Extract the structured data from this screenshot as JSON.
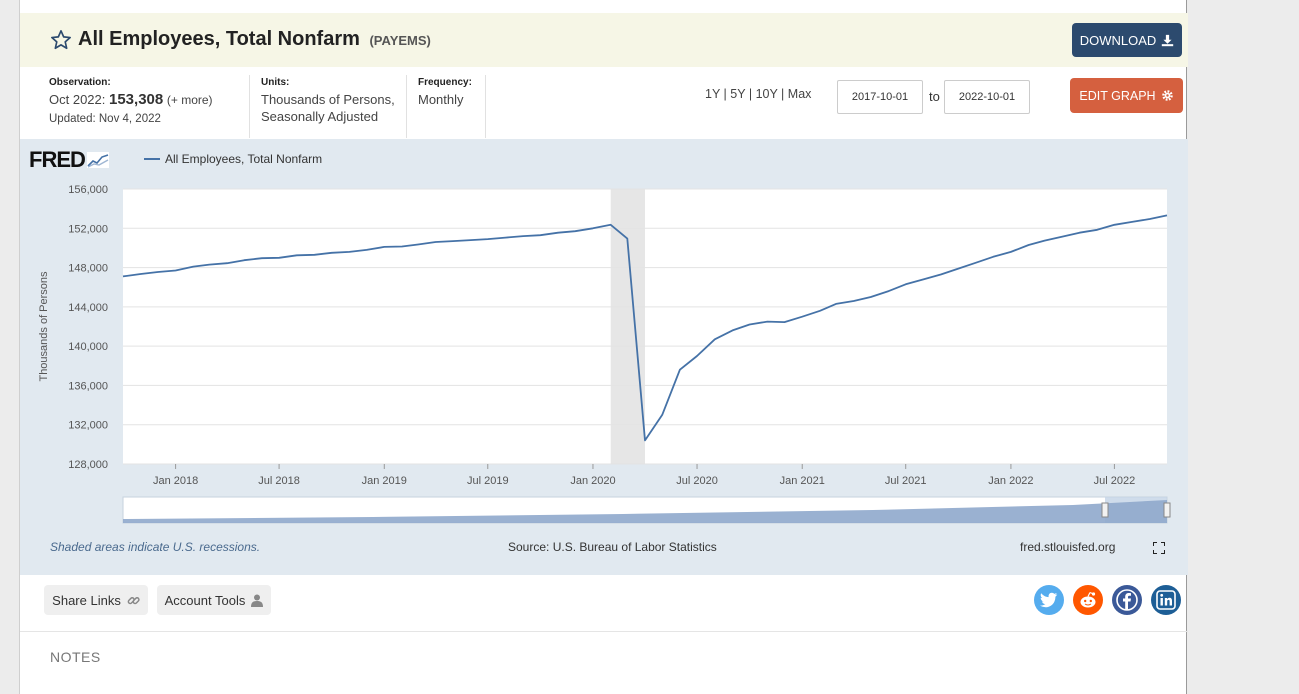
{
  "header": {
    "title": "All Employees, Total Nonfarm",
    "series_id": "(PAYEMS)",
    "download_label": "DOWNLOAD"
  },
  "meta": {
    "observation_label": "Observation:",
    "observation_date": "Oct 2022:",
    "observation_value": "153,308",
    "observation_more": "(+ more)",
    "updated": "Updated: Nov 4, 2022",
    "units_label": "Units:",
    "units_line1": "Thousands of Persons,",
    "units_line2": "Seasonally Adjusted",
    "frequency_label": "Frequency:",
    "frequency_value": "Monthly"
  },
  "controls": {
    "ranges": [
      "1Y",
      "5Y",
      "10Y",
      "Max"
    ],
    "start_date": "2017-10-01",
    "end_date": "2022-10-01",
    "to_label": "to",
    "edit_label": "EDIT GRAPH"
  },
  "graph": {
    "logo": "FRED",
    "recession_note": "Shaded areas indicate U.S. recessions.",
    "source": "Source: U.S. Bureau of Labor Statistics",
    "site": "fred.stlouisfed.org"
  },
  "chart_data": {
    "type": "line",
    "ylabel": "Thousands of Persons",
    "ylim": [
      128000,
      156000
    ],
    "yticks": [
      128000,
      132000,
      136000,
      140000,
      144000,
      148000,
      152000,
      156000
    ],
    "ytick_labels": [
      "128,000",
      "132,000",
      "136,000",
      "140,000",
      "144,000",
      "148,000",
      "152,000",
      "156,000"
    ],
    "xlim": [
      "2017-10-01",
      "2022-10-01"
    ],
    "xticks": [
      "2018-01-01",
      "2018-07-01",
      "2019-01-01",
      "2019-07-01",
      "2020-01-01",
      "2020-07-01",
      "2021-01-01",
      "2021-07-01",
      "2022-01-01",
      "2022-07-01"
    ],
    "xtick_labels": [
      "Jan 2018",
      "Jul 2018",
      "Jan 2019",
      "Jul 2019",
      "Jan 2020",
      "Jul 2020",
      "Jan 2021",
      "Jul 2021",
      "Jan 2022",
      "Jul 2022"
    ],
    "grid": true,
    "recession": [
      "2020-02-01",
      "2020-04-01"
    ],
    "series": [
      {
        "name": "All Employees, Total Nonfarm",
        "color": "#4572a7",
        "x": [
          "2017-10-01",
          "2017-11-01",
          "2017-12-01",
          "2018-01-01",
          "2018-02-01",
          "2018-03-01",
          "2018-04-01",
          "2018-05-01",
          "2018-06-01",
          "2018-07-01",
          "2018-08-01",
          "2018-09-01",
          "2018-10-01",
          "2018-11-01",
          "2018-12-01",
          "2019-01-01",
          "2019-02-01",
          "2019-03-01",
          "2019-04-01",
          "2019-05-01",
          "2019-06-01",
          "2019-07-01",
          "2019-08-01",
          "2019-09-01",
          "2019-10-01",
          "2019-11-01",
          "2019-12-01",
          "2020-01-01",
          "2020-02-01",
          "2020-03-01",
          "2020-04-01",
          "2020-05-01",
          "2020-06-01",
          "2020-07-01",
          "2020-08-01",
          "2020-09-01",
          "2020-10-01",
          "2020-11-01",
          "2020-12-01",
          "2021-01-01",
          "2021-02-01",
          "2021-03-01",
          "2021-04-01",
          "2021-05-01",
          "2021-06-01",
          "2021-07-01",
          "2021-08-01",
          "2021-09-01",
          "2021-10-01",
          "2021-11-01",
          "2021-12-01",
          "2022-01-01",
          "2022-02-01",
          "2022-03-01",
          "2022-04-01",
          "2022-05-01",
          "2022-06-01",
          "2022-07-01",
          "2022-08-01",
          "2022-09-01",
          "2022-10-01"
        ],
        "values": [
          147100,
          147350,
          147550,
          147700,
          148100,
          148300,
          148450,
          148750,
          148950,
          149000,
          149250,
          149300,
          149500,
          149600,
          149800,
          150100,
          150150,
          150350,
          150600,
          150700,
          150800,
          150900,
          151050,
          151200,
          151300,
          151550,
          151700,
          152000,
          152350,
          150950,
          130400,
          133000,
          137600,
          139000,
          140700,
          141600,
          142200,
          142500,
          142450,
          143000,
          143600,
          144300,
          144600,
          145000,
          145600,
          146300,
          146800,
          147300,
          147900,
          148500,
          149100,
          149600,
          150300,
          150750,
          151150,
          151550,
          151850,
          152350,
          152650,
          152950,
          153308
        ]
      }
    ]
  },
  "share": {
    "share_links": "Share Links",
    "account_tools": "Account Tools"
  },
  "notes_label": "NOTES"
}
